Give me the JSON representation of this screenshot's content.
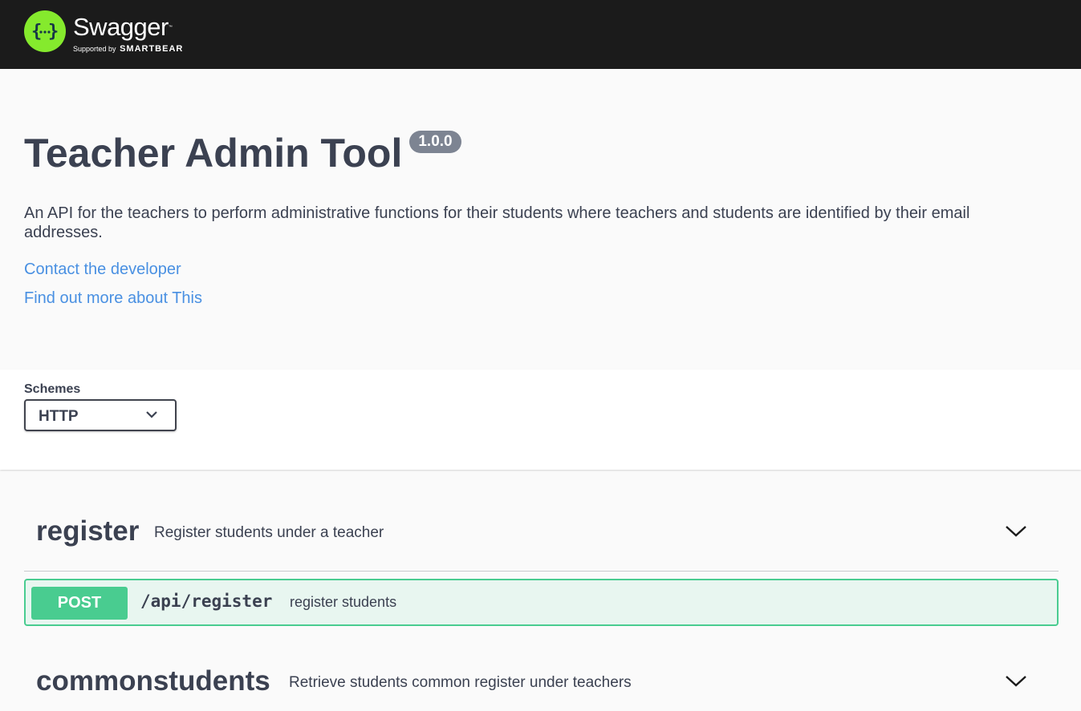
{
  "topbar": {
    "logo_name": "Swagger",
    "logo_tm": "™",
    "logo_supported": "Supported by",
    "logo_brand": "SMARTBEAR",
    "colors": {
      "background": "#1b1b1b",
      "logo": "#85ea2d"
    }
  },
  "info": {
    "title": "Teacher Admin Tool",
    "version": "1.0.0",
    "description": "An API for the teachers to perform administrative functions for their students where teachers and students are identified by their email addresses.",
    "links": [
      "Contact the developer",
      "Find out more about This"
    ]
  },
  "schemes": {
    "label": "Schemes",
    "selected": "HTTP"
  },
  "tags": [
    {
      "name": "register",
      "description": "Register students under a teacher",
      "operations": [
        {
          "method": "POST",
          "path": "/api/register",
          "summary": "register students"
        }
      ]
    },
    {
      "name": "commonstudents",
      "description": "Retrieve students common register under teachers"
    }
  ]
}
